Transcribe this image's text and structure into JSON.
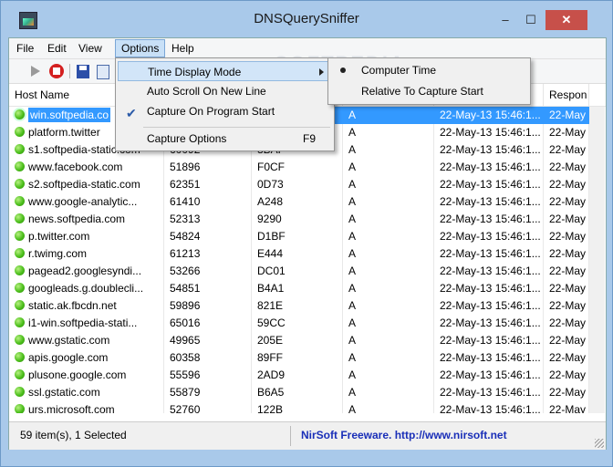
{
  "window": {
    "title": "DNSQuerySniffer",
    "minimize": "–",
    "maximize": "☐",
    "close": "✕"
  },
  "menubar": {
    "items": [
      {
        "label": "File"
      },
      {
        "label": "Edit"
      },
      {
        "label": "View"
      },
      {
        "label": "Options"
      },
      {
        "label": "Help"
      }
    ]
  },
  "options_menu": {
    "items": [
      {
        "label": "Time Display Mode",
        "submenu": true
      },
      {
        "label": "Auto Scroll On New Line"
      },
      {
        "label": "Capture On Program Start",
        "checked": true
      },
      {
        "label": "Capture Options",
        "shortcut": "F9"
      }
    ]
  },
  "time_submenu": {
    "items": [
      {
        "label": "Computer Time",
        "selected": true
      },
      {
        "label": "Relative To Capture Start"
      }
    ]
  },
  "table": {
    "columns": [
      "Host Name",
      "",
      "",
      "",
      "",
      "Respon"
    ],
    "rows": [
      [
        "win.softpedia.co",
        "",
        "",
        "A",
        "22-May-13 15:46:1...",
        "22-May"
      ],
      [
        "platform.twitter",
        "",
        "",
        "A",
        "22-May-13 15:46:1...",
        "22-May"
      ],
      [
        "s1.softpedia-static.com",
        "60092",
        "8BAF",
        "A",
        "22-May-13 15:46:1...",
        "22-May"
      ],
      [
        "www.facebook.com",
        "51896",
        "F0CF",
        "A",
        "22-May-13 15:46:1...",
        "22-May"
      ],
      [
        "s2.softpedia-static.com",
        "62351",
        "0D73",
        "A",
        "22-May-13 15:46:1...",
        "22-May"
      ],
      [
        "www.google-analytic...",
        "61410",
        "A248",
        "A",
        "22-May-13 15:46:1...",
        "22-May"
      ],
      [
        "news.softpedia.com",
        "52313",
        "9290",
        "A",
        "22-May-13 15:46:1...",
        "22-May"
      ],
      [
        "p.twitter.com",
        "54824",
        "D1BF",
        "A",
        "22-May-13 15:46:1...",
        "22-May"
      ],
      [
        "r.twimg.com",
        "61213",
        "E444",
        "A",
        "22-May-13 15:46:1...",
        "22-May"
      ],
      [
        "pagead2.googlesyndi...",
        "53266",
        "DC01",
        "A",
        "22-May-13 15:46:1...",
        "22-May"
      ],
      [
        "googleads.g.doublecli...",
        "54851",
        "B4A1",
        "A",
        "22-May-13 15:46:1...",
        "22-May"
      ],
      [
        "static.ak.fbcdn.net",
        "59896",
        "821E",
        "A",
        "22-May-13 15:46:1...",
        "22-May"
      ],
      [
        "i1-win.softpedia-stati...",
        "65016",
        "59CC",
        "A",
        "22-May-13 15:46:1...",
        "22-May"
      ],
      [
        "www.gstatic.com",
        "49965",
        "205E",
        "A",
        "22-May-13 15:46:1...",
        "22-May"
      ],
      [
        "apis.google.com",
        "60358",
        "89FF",
        "A",
        "22-May-13 15:46:1...",
        "22-May"
      ],
      [
        "plusone.google.com",
        "55596",
        "2AD9",
        "A",
        "22-May-13 15:46:1...",
        "22-May"
      ],
      [
        "ssl.gstatic.com",
        "55879",
        "B6A5",
        "A",
        "22-May-13 15:46:1...",
        "22-May"
      ],
      [
        "urs.microsoft.com",
        "52760",
        "122B",
        "A",
        "22-May-13 15:46:1...",
        "22-May"
      ]
    ]
  },
  "status": {
    "left": "59 item(s), 1 Selected",
    "right": "NirSoft Freeware.  http://www.nirsoft.net"
  },
  "watermark": "SOFTPEDIA",
  "colors": {
    "selection": "#3399ff",
    "frame": "#a9c9ea",
    "link": "#1a2fb8"
  }
}
